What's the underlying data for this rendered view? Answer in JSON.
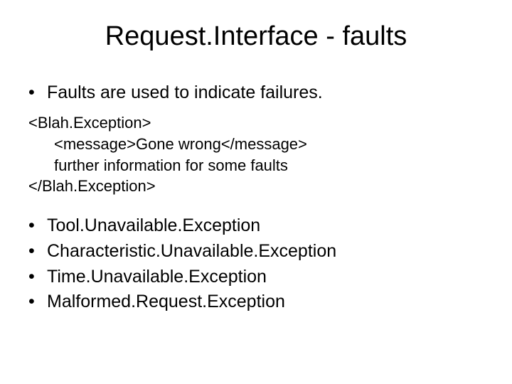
{
  "title": "Request.Interface - faults",
  "intro_bullet": "Faults are used to indicate failures.",
  "code": {
    "l1": "<Blah.Exception>",
    "l2": "<message>Gone wrong</message>",
    "l3": "further information for some faults",
    "l4": "</Blah.Exception>"
  },
  "exceptions": {
    "i1": "Tool.Unavailable.Exception",
    "i2": "Characteristic.Unavailable.Exception",
    "i3": "Time.Unavailable.Exception",
    "i4": "Malformed.Request.Exception"
  }
}
